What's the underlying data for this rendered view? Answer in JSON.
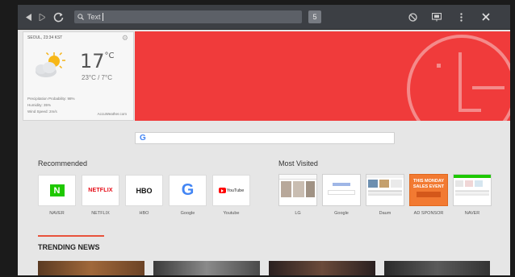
{
  "browser": {
    "url_text": "Text",
    "tab_count": "5"
  },
  "weather": {
    "location_time": "SEOUL, 23:34 KST",
    "temperature": "17",
    "unit": "°C",
    "range": "23°C / 7°C",
    "precipitation": "Precipitation Probability: 98%",
    "humidity": "Humidity: 35%",
    "wind": "Wind Speed: 2m/s",
    "source": "AccuWeather.com"
  },
  "search": {
    "logo": "G"
  },
  "recommended": {
    "title": "Recommended",
    "items": [
      {
        "label": "NAVER",
        "logo": "N"
      },
      {
        "label": "NETFLIX",
        "logo": "NETFLIX"
      },
      {
        "label": "HBO",
        "logo": "HBO"
      },
      {
        "label": "Google",
        "logo": "G"
      },
      {
        "label": "Youtube",
        "logo": "YouTube"
      }
    ]
  },
  "most_visited": {
    "title": "Most Visited",
    "items": [
      {
        "label": "LG"
      },
      {
        "label": "Google"
      },
      {
        "label": "Daum"
      },
      {
        "label": "AD SPONSOR",
        "ad_text": "THIS MONDAY SALES EVENT"
      },
      {
        "label": "NAVER"
      }
    ]
  },
  "trending": {
    "title": "TRENDING NEWS"
  },
  "colors": {
    "banner_red": "#f03b3b",
    "naver_green": "#1ec800",
    "netflix_red": "#e50914",
    "youtube_red": "#ff0000",
    "accent": "#e8533c"
  }
}
